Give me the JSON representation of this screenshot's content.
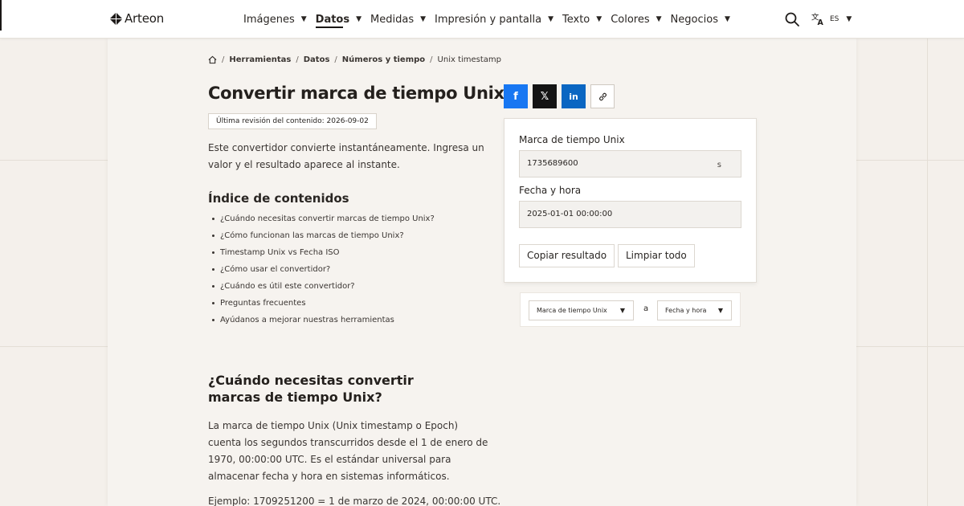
{
  "brand": {
    "name": "Arteon"
  },
  "nav": {
    "items": [
      {
        "label": "Imágenes",
        "active": false
      },
      {
        "label": "Datos",
        "active": true
      },
      {
        "label": "Medidas",
        "active": false
      },
      {
        "label": "Impresión y pantalla",
        "active": false
      },
      {
        "label": "Texto",
        "active": false
      },
      {
        "label": "Colores",
        "active": false
      },
      {
        "label": "Negocios",
        "active": false
      }
    ],
    "caret": "▼",
    "search_icon": "search-icon",
    "language": "ES"
  },
  "breadcrumb": {
    "home_icon": "home-icon",
    "separator": "/",
    "items": [
      "Herramientas",
      "Datos",
      "Números y tiempo",
      "Unix timestamp"
    ]
  },
  "page": {
    "title": "Convertir marca de tiempo Unix",
    "revision": "Última revisión del contenido: 2026-09-02",
    "intro": "Este convertidor convierte instantáneamente. Ingresa un valor y el resultado aparece al instante."
  },
  "toc": {
    "title": "Índice de contenidos",
    "items": [
      "¿Cuándo necesitas convertir marcas de tiempo Unix?",
      "¿Cómo funcionan las marcas de tiempo Unix?",
      "Timestamp Unix vs Fecha ISO",
      "¿Cómo usar el convertidor?",
      "¿Cuándo es útil este convertidor?",
      "Preguntas frecuentes",
      "Ayúdanos a mejorar nuestras herramientas"
    ]
  },
  "section1": {
    "title": "¿Cuándo necesitas convertir marcas de tiempo Unix?",
    "body": "La marca de tiempo Unix (Unix timestamp o Epoch) cuenta los segundos transcurridos desde el 1 de enero de 1970, 00:00:00 UTC. Es el estándar universal para almacenar fecha y hora en sistemas informáticos.",
    "example": "Ejemplo: 1709251200 = 1 de marzo de 2024, 00:00:00 UTC."
  },
  "share": {
    "facebook": "f",
    "x": "𝕏",
    "linkedin": "in",
    "link_icon": "link-icon"
  },
  "converter": {
    "input_label": "Marca de tiempo Unix",
    "input_value": "1735689600",
    "input_unit": "s",
    "output_label": "Fecha y hora",
    "output_value": "2025-01-01 00:00:00",
    "copy_button": "Copiar resultado",
    "clear_button": "Limpiar todo"
  },
  "convert_bar": {
    "from": "Marca de tiempo Unix",
    "connector": "a",
    "to": "Fecha y hora"
  },
  "colors": {
    "facebook": "#1877f2",
    "x": "#141414",
    "linkedin": "#0a66c2",
    "background": "#f4f0eb"
  }
}
